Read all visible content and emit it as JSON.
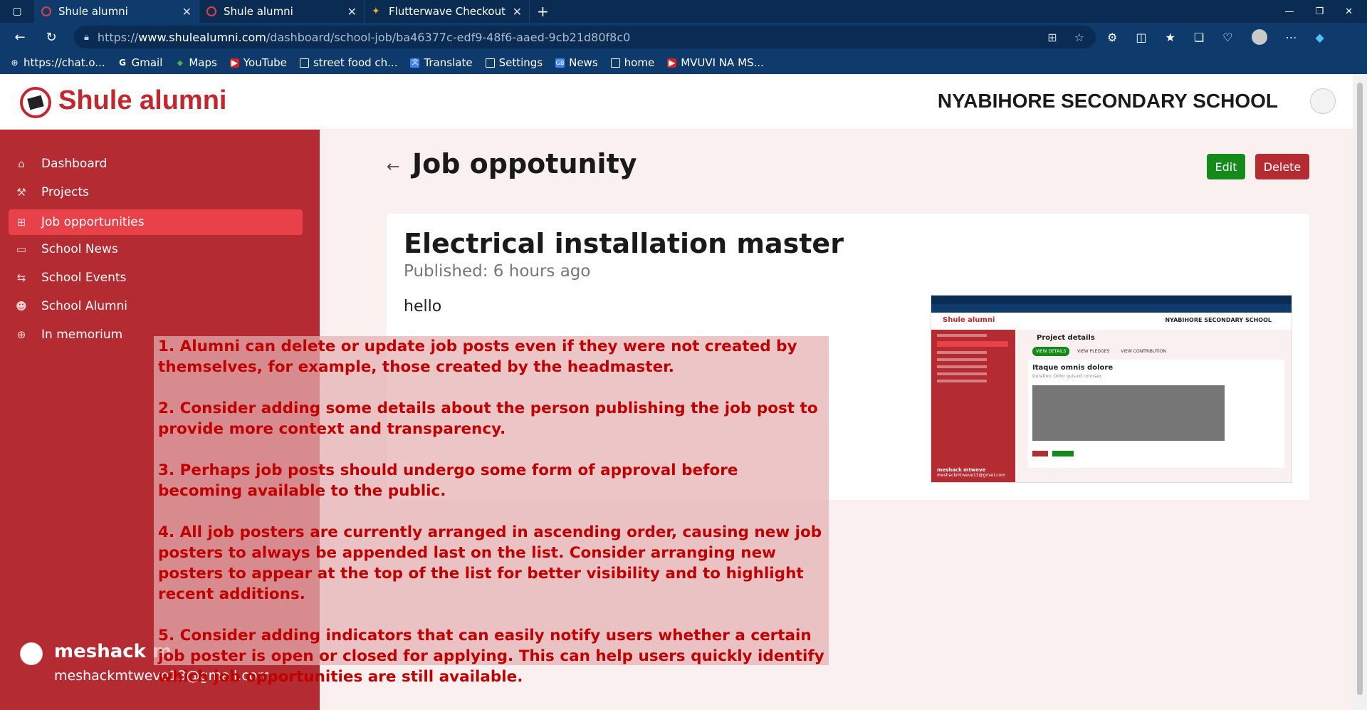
{
  "browser": {
    "tabs": [
      {
        "title": "Shule alumni",
        "active": true
      },
      {
        "title": "Shule alumni",
        "active": false
      },
      {
        "title": "Flutterwave Checkout",
        "active": false
      }
    ],
    "url_prefix": "https://",
    "url_host": "www.shulealumni.com",
    "url_path": "/dashboard/school-job/ba46377c-edf9-48f6-aaed-9cb21d80f8c0",
    "bookmarks": [
      {
        "label": "https://chat.o...",
        "icon": "openai-icon"
      },
      {
        "label": "Gmail",
        "icon": "google-icon"
      },
      {
        "label": "Maps",
        "icon": "maps-icon"
      },
      {
        "label": "YouTube",
        "icon": "youtube-icon"
      },
      {
        "label": "street food ch...",
        "icon": "page-icon"
      },
      {
        "label": "Translate",
        "icon": "translate-icon"
      },
      {
        "label": "Settings",
        "icon": "page-icon"
      },
      {
        "label": "News",
        "icon": "news-icon"
      },
      {
        "label": "home",
        "icon": "page-icon"
      },
      {
        "label": "MVUVI NA MS...",
        "icon": "youtube-icon"
      }
    ]
  },
  "header": {
    "brand": "Shule alumni",
    "school": "NYABIHORE SECONDARY SCHOOL"
  },
  "sidebar": {
    "items": [
      {
        "label": "Dashboard",
        "icon": "home-icon",
        "active": false
      },
      {
        "label": "Projects",
        "icon": "hammer-icon",
        "active": false
      },
      {
        "label": "Job opportunities",
        "icon": "sitemap-icon",
        "active": true
      },
      {
        "label": "School News",
        "icon": "monitor-icon",
        "active": false
      },
      {
        "label": "School Events",
        "icon": "events-icon",
        "active": false
      },
      {
        "label": "School Alumni",
        "icon": "users-icon",
        "active": false
      },
      {
        "label": "In memorium",
        "icon": "plus-circle-icon",
        "active": false
      }
    ],
    "user": {
      "name": "meshack m",
      "email": "meshackmtweve13@gmail.com"
    }
  },
  "main": {
    "title": "Job oppotunity",
    "edit_label": "Edit",
    "delete_label": "Delete",
    "job": {
      "title": "Electrical installation master",
      "published": "Published: 6 hours ago",
      "description": "hello"
    },
    "poster": {
      "brand": "Shule alumni",
      "school": "NYABIHORE SECONDARY SCHOOL",
      "title": "Project details",
      "tabs": [
        "VIEW DETAILS",
        "VIEW PLEDGES",
        "VIEW CONTRIBUTION"
      ],
      "card_title": "Itaque omnis dolore",
      "card_sub": "Duration: Dolor quisuid connsaq",
      "user_name": "meshack mtweve",
      "user_email": "meshackmtweve13@gmail.com"
    }
  },
  "overlay": {
    "notes": [
      "1. Alumni can delete or update job posts even if they were not created by themselves, for example, those created by the headmaster.",
      "2. Consider adding some details about the person publishing the job post to provide more context and transparency.",
      "3. Perhaps job posts should undergo some form of approval before becoming available to the public.",
      "4. All job posters are currently arranged in ascending order, causing new job posters to always be appended last on the list. Consider arranging new posters to appear at the top of the list for better visibility and to highlight recent additions.",
      "5. Consider adding indicators that can easily notify users whether a certain job poster is open or closed for applying. This can help users quickly identify which job opportunities are still available."
    ]
  }
}
